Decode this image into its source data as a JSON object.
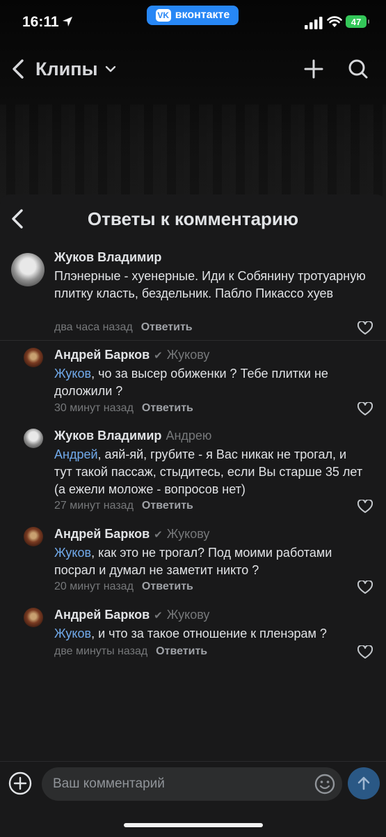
{
  "status_bar": {
    "time": "16:11",
    "app_badge": "вконтакте",
    "vk_logo": "VK",
    "battery": "47"
  },
  "top_nav": {
    "title": "Клипы"
  },
  "sheet": {
    "title": "Ответы к комментарию"
  },
  "comments": [
    {
      "author": "Жуков Владимир",
      "reply_to": "",
      "mention": "",
      "text": "Плэнерные - хуенерные. Иди к Собянину тротуарную плитку класть, бездельник. Пабло Пикассо хуев",
      "time": "два часа назад",
      "reply_label": "Ответить"
    },
    {
      "author": "Андрей Барков",
      "reply_to": "Жукову",
      "mention": "Жуков",
      "text": ", чо за высер обиженки ? Тебе плитки не доложили ?",
      "time": "30 минут назад",
      "reply_label": "Ответить"
    },
    {
      "author": "Жуков Владимир",
      "reply_to": "Андрею",
      "mention": "Андрей",
      "text": ", аяй-яй, грубите - я Вас никак не трогал, и тут такой пассаж, стыдитесь, если Вы старше 35 лет (а ежели моложе - вопросов нет)",
      "time": "27 минут назад",
      "reply_label": "Ответить"
    },
    {
      "author": "Андрей Барков",
      "reply_to": "Жукову",
      "mention": "Жуков",
      "text": ", как это не трогал? Под моими работами посрал и думал не заметит никто ?",
      "time": "20 минут назад",
      "reply_label": "Ответить"
    },
    {
      "author": "Андрей Барков",
      "reply_to": "Жукову",
      "mention": "Жуков",
      "text": ", и что за такое отношение к пленэрам ?",
      "time": "две минуты назад",
      "reply_label": "Ответить"
    }
  ],
  "input": {
    "placeholder": "Ваш комментарий"
  },
  "colors": {
    "accent": "#2787f5",
    "mention": "#71aaeb",
    "sheet_bg": "#19191a",
    "send_button": "#2a5885"
  }
}
